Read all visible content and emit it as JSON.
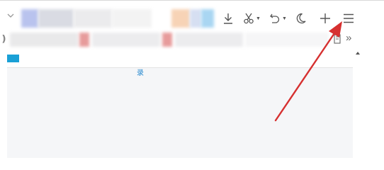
{
  "icons": {
    "download": "download-icon",
    "screenshot": "scissors-icon",
    "undo": "undo-icon",
    "night_mode": "moon-icon",
    "new_tab": "plus-icon",
    "menu": "hamburger-menu-icon",
    "bookmark": "bookmark-icon"
  },
  "content": {
    "link_text": "录"
  },
  "colors": {
    "accent": "#1aa0d6",
    "annotation_arrow": "#d63030"
  }
}
